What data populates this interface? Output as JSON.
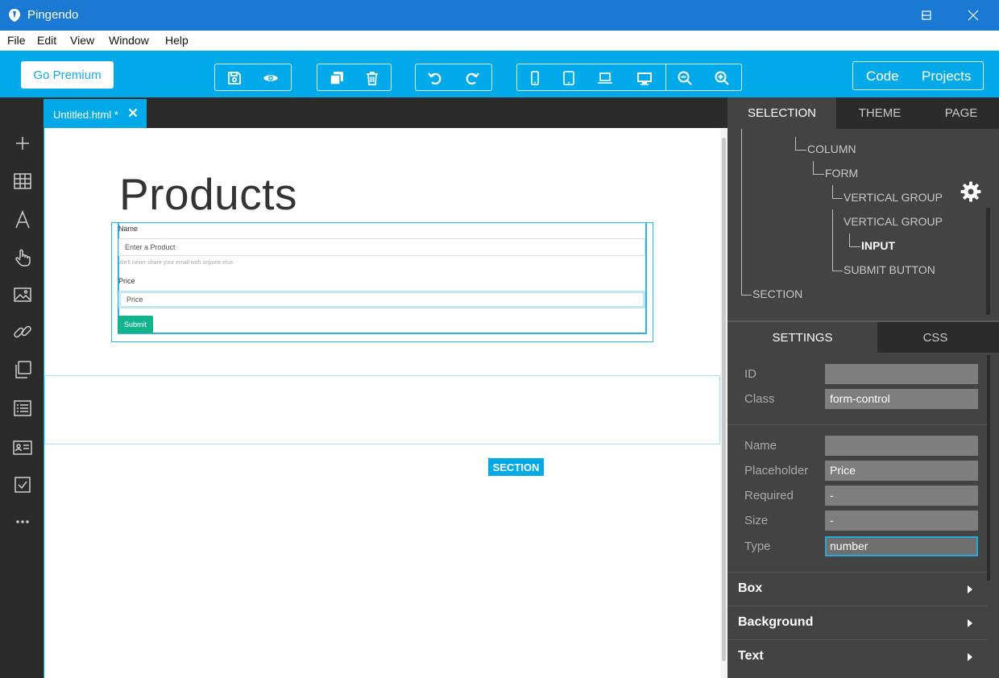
{
  "window": {
    "title": "Pingendo",
    "controls": {
      "minimize": "minimize-icon",
      "maximize": "maximize-icon",
      "close": "close-icon"
    }
  },
  "menu": [
    "File",
    "Edit",
    "View",
    "Window",
    "Help"
  ],
  "toolbar": {
    "premium_label": "Go Premium",
    "code_label": "Code",
    "projects_label": "Projects",
    "accent": "#00a9e8"
  },
  "sidebar_icons": [
    "plus-icon",
    "grid-icon",
    "text-icon",
    "hand-pointer-icon",
    "image-icon",
    "link-icon",
    "copy-icon",
    "list-icon",
    "card-icon",
    "checkbox-icon",
    "more-icon"
  ],
  "editor_tab": {
    "label": "Untitled.html *"
  },
  "canvas": {
    "title": "Products",
    "form": {
      "name_label": "Name",
      "name_placeholder": "Enter a Product",
      "help_text": "We'll never share your email with anyone else.",
      "price_label": "Price",
      "price_placeholder": "Price",
      "submit_label": "Submit",
      "submit_color": "#12b48e"
    },
    "section_tag": "SECTION"
  },
  "right_panel": {
    "tabs": [
      "SELECTION",
      "THEME",
      "PAGE"
    ],
    "tree": {
      "column": "COLUMN",
      "form": "FORM",
      "group1": "VERTICAL GROUP",
      "group2": "VERTICAL GROUP",
      "input": "INPUT",
      "submit": "SUBMIT BUTTON",
      "section": "SECTION"
    },
    "settings_tabs": [
      "SETTINGS",
      "CSS"
    ],
    "fields": {
      "id_label": "ID",
      "id_value": "",
      "class_label": "Class",
      "class_value": "form-control",
      "name_label": "Name",
      "name_value": "",
      "placeholder_label": "Placeholder",
      "placeholder_value": "Price",
      "required_label": "Required",
      "required_value": "-",
      "size_label": "Size",
      "size_value": "-",
      "type_label": "Type",
      "type_value": "number"
    },
    "accordions": [
      "Box",
      "Background",
      "Text"
    ]
  }
}
